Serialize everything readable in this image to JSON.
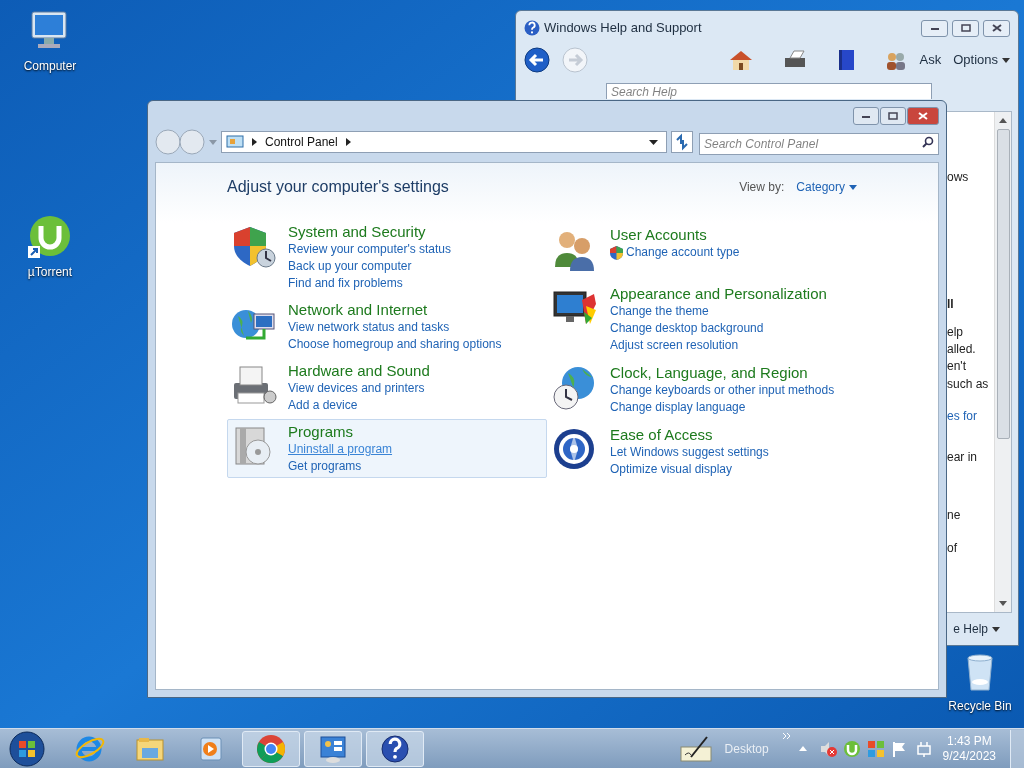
{
  "desktop_icons": [
    {
      "label": "Computer",
      "kind": "computer"
    },
    {
      "label": "µTorrent",
      "kind": "utorrent"
    },
    {
      "label": "Recycle Bin",
      "kind": "recycle"
    }
  ],
  "help_window": {
    "title": "Windows Help and Support",
    "toolbar": [
      "Ask",
      "Options"
    ],
    "search_placeholder": "Search Help",
    "fragments": [
      {
        "text": "ows",
        "kind": "text"
      },
      {
        "text": "ll",
        "kind": "bold"
      },
      {
        "text": "elp",
        "kind": "text"
      },
      {
        "text": "alled.",
        "kind": "text"
      },
      {
        "text": "en't",
        "kind": "text"
      },
      {
        "text": "such as",
        "kind": "text"
      },
      {
        "text": "es for",
        "kind": "link"
      },
      {
        "text": "ear in",
        "kind": "text"
      },
      {
        "text": "ne",
        "kind": "text"
      },
      {
        "text": "of",
        "kind": "text"
      }
    ],
    "footer": "e Help"
  },
  "control_panel": {
    "breadcrumb": "Control Panel",
    "search_placeholder": "Search Control Panel",
    "heading": "Adjust your computer's settings",
    "view_by_label": "View by:",
    "view_by_value": "Category",
    "columns": [
      [
        {
          "title": "System and Security",
          "hovered": false,
          "links": [
            {
              "text": "Review your computer's status",
              "hovered": false,
              "shield": false
            },
            {
              "text": "Back up your computer",
              "hovered": false,
              "shield": false
            },
            {
              "text": "Find and fix problems",
              "hovered": false,
              "shield": false
            }
          ]
        },
        {
          "title": "Network and Internet",
          "hovered": false,
          "links": [
            {
              "text": "View network status and tasks",
              "hovered": false,
              "shield": false
            },
            {
              "text": "Choose homegroup and sharing options",
              "hovered": false,
              "shield": false
            }
          ]
        },
        {
          "title": "Hardware and Sound",
          "hovered": false,
          "links": [
            {
              "text": "View devices and printers",
              "hovered": false,
              "shield": false
            },
            {
              "text": "Add a device",
              "hovered": false,
              "shield": false
            }
          ]
        },
        {
          "title": "Programs",
          "hovered": true,
          "links": [
            {
              "text": "Uninstall a program",
              "hovered": true,
              "shield": false
            },
            {
              "text": "Get programs",
              "hovered": false,
              "shield": false
            }
          ]
        }
      ],
      [
        {
          "title": "User Accounts",
          "hovered": false,
          "links": [
            {
              "text": "Change account type",
              "hovered": false,
              "shield": true
            }
          ]
        },
        {
          "title": "Appearance and Personalization",
          "hovered": false,
          "links": [
            {
              "text": "Change the theme",
              "hovered": false,
              "shield": false
            },
            {
              "text": "Change desktop background",
              "hovered": false,
              "shield": false
            },
            {
              "text": "Adjust screen resolution",
              "hovered": false,
              "shield": false
            }
          ]
        },
        {
          "title": "Clock, Language, and Region",
          "hovered": false,
          "links": [
            {
              "text": "Change keyboards or other input methods",
              "hovered": false,
              "shield": false
            },
            {
              "text": "Change display language",
              "hovered": false,
              "shield": false
            }
          ]
        },
        {
          "title": "Ease of Access",
          "hovered": false,
          "links": [
            {
              "text": "Let Windows suggest settings",
              "hovered": false,
              "shield": false
            },
            {
              "text": "Optimize visual display",
              "hovered": false,
              "shield": false
            }
          ]
        }
      ]
    ]
  },
  "taskbar": {
    "items": [
      {
        "kind": "ie",
        "open": false
      },
      {
        "kind": "explorer",
        "open": false
      },
      {
        "kind": "media",
        "open": false
      },
      {
        "kind": "chrome",
        "open": true
      },
      {
        "kind": "controlpanel",
        "open": true
      },
      {
        "kind": "help",
        "open": true
      }
    ],
    "desktop_label": "Desktop",
    "time": "1:43 PM",
    "date": "9/24/2023"
  }
}
